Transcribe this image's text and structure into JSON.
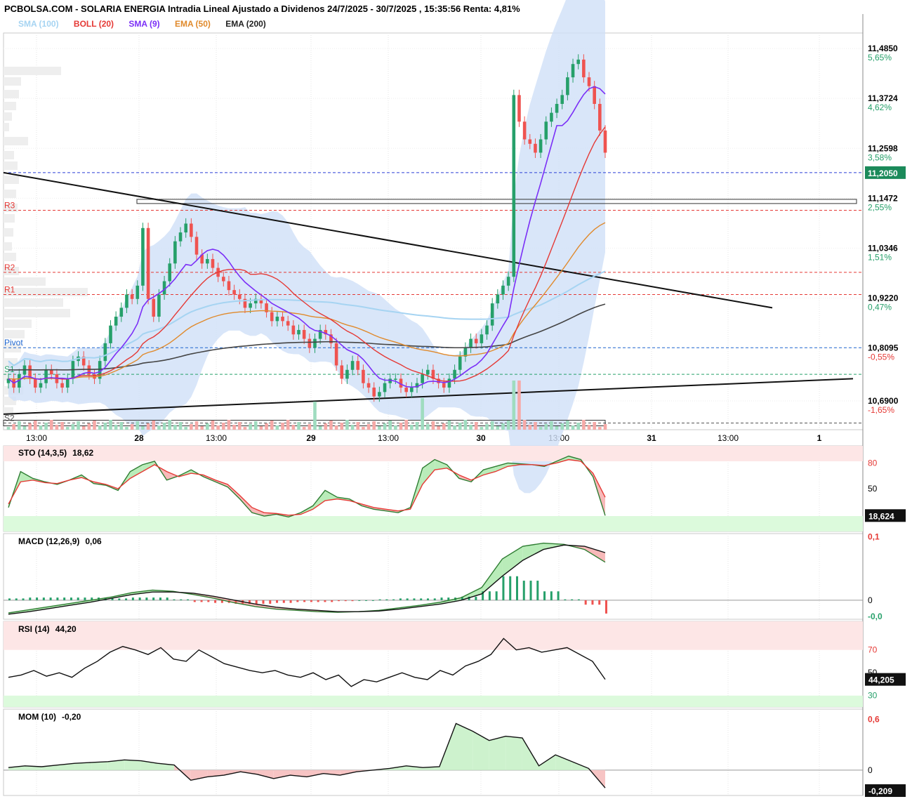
{
  "header": {
    "title": "PCBOLSA.COM - SOLARIA ENERGIA Intradia Lineal Ajustado a Dividenos 24/7/2025 - 30/7/2025 , 15:35:56 Renta: 4,81%"
  },
  "legend": [
    {
      "label": "SMA (100)",
      "color": "#a6d4f2"
    },
    {
      "label": "BOLL (20)",
      "color": "#e53935"
    },
    {
      "label": "SMA (9)",
      "color": "#7b2ff7"
    },
    {
      "label": "EMA (50)",
      "color": "#e08a2c"
    },
    {
      "label": "EMA (200)",
      "color": "#333333"
    }
  ],
  "colors": {
    "up": "#26a06a",
    "down": "#ef5350",
    "band": "#cfe0f7",
    "last_tag": "#1b8a5a"
  },
  "price_axis": {
    "ticks": [
      {
        "value": "11,4850",
        "pct": "5,65%"
      },
      {
        "value": "11,3724",
        "pct": "4,62%"
      },
      {
        "value": "11,2598",
        "pct": "3,58%"
      },
      {
        "value": "11,1472",
        "pct": "2,55%"
      },
      {
        "value": "11,0346",
        "pct": "1,51%"
      },
      {
        "value": "10,9220",
        "pct": "0,47%"
      },
      {
        "value": "10,8095",
        "pct": "-0,55%"
      },
      {
        "value": "10,6900",
        "pct": "-1,65%"
      }
    ],
    "last_price": "11,2050"
  },
  "x_axis": [
    "13:00",
    "28",
    "13:00",
    "29",
    "13:00",
    "30",
    "13:00",
    "31",
    "13:00",
    "1"
  ],
  "pivots": [
    {
      "label": "R3",
      "value": 11.12
    },
    {
      "label": "R2",
      "value": 10.98
    },
    {
      "label": "R1",
      "value": 10.93
    },
    {
      "label": "Pivot",
      "value": 10.81
    },
    {
      "label": "S1",
      "value": 10.75
    },
    {
      "label": "S2",
      "value": 10.64
    }
  ],
  "panels": {
    "sto": {
      "title": "STO (14,3,5)",
      "value": "18,62",
      "ticks": [
        "80",
        "50"
      ],
      "last": "18,624"
    },
    "macd": {
      "title": "MACD (12,26,9)",
      "value": "0,06",
      "ticks": [
        "0,1",
        "0",
        "-0,0"
      ]
    },
    "rsi": {
      "title": "RSI (14)",
      "value": "44,20",
      "ticks": [
        "70",
        "50",
        "30"
      ],
      "last": "44,205"
    },
    "mom": {
      "title": "MOM (10)",
      "value": "-0,20",
      "ticks": [
        "0,6",
        "0"
      ],
      "last": "-0,209"
    }
  },
  "chart_data": {
    "type": "candlestick",
    "close_series": [
      10.74,
      10.72,
      10.75,
      10.77,
      10.74,
      10.72,
      10.73,
      10.76,
      10.75,
      10.73,
      10.72,
      10.74,
      10.78,
      10.79,
      10.77,
      10.75,
      10.74,
      10.78,
      10.82,
      10.86,
      10.88,
      10.9,
      10.93,
      10.92,
      10.95,
      11.08,
      10.92,
      10.88,
      10.93,
      10.96,
      11.0,
      11.05,
      11.07,
      11.09,
      11.06,
      11.02,
      11.0,
      11.01,
      10.99,
      10.97,
      10.96,
      10.94,
      10.93,
      10.92,
      10.9,
      10.91,
      10.92,
      10.91,
      10.89,
      10.87,
      10.88,
      10.87,
      10.86,
      10.84,
      10.85,
      10.83,
      10.81,
      10.83,
      10.85,
      10.84,
      10.82,
      10.77,
      10.74,
      10.76,
      10.78,
      10.76,
      10.73,
      10.72,
      10.7,
      10.71,
      10.73,
      10.74,
      10.74,
      10.72,
      10.71,
      10.72,
      10.73,
      10.75,
      10.76,
      10.74,
      10.73,
      10.72,
      10.74,
      10.76,
      10.79,
      10.81,
      10.83,
      10.82,
      10.84,
      10.86,
      10.91,
      10.93,
      10.95,
      10.97,
      11.38,
      11.32,
      11.28,
      11.27,
      11.25,
      11.28,
      11.32,
      11.34,
      11.36,
      11.38,
      11.42,
      11.45,
      11.46,
      11.42,
      11.4,
      11.36,
      11.3,
      11.25
    ],
    "sto": {
      "k": [
        28,
        70,
        62,
        58,
        55,
        60,
        66,
        56,
        54,
        48,
        70,
        78,
        82,
        60,
        65,
        72,
        64,
        58,
        52,
        38,
        22,
        18,
        20,
        17,
        22,
        30,
        48,
        40,
        38,
        30,
        26,
        24,
        22,
        28,
        74,
        84,
        78,
        62,
        58,
        72,
        76,
        80,
        79,
        78,
        76,
        82,
        88,
        84,
        64,
        18.6
      ],
      "d": [
        32,
        58,
        60,
        57,
        56,
        60,
        63,
        58,
        55,
        50,
        62,
        70,
        78,
        70,
        64,
        68,
        66,
        60,
        55,
        42,
        28,
        22,
        21,
        19,
        20,
        26,
        36,
        38,
        36,
        32,
        28,
        26,
        24,
        26,
        55,
        72,
        74,
        66,
        60,
        66,
        70,
        76,
        78,
        78,
        77,
        80,
        84,
        82,
        68,
        40
      ]
    },
    "macd": {
      "macd": [
        -0.02,
        -0.015,
        -0.01,
        -0.005,
        0.0,
        0.005,
        0.012,
        0.016,
        0.014,
        0.009,
        0.003,
        -0.004,
        -0.01,
        -0.014,
        -0.016,
        -0.018,
        -0.019,
        -0.018,
        -0.016,
        -0.012,
        -0.008,
        -0.003,
        0.004,
        0.02,
        0.065,
        0.085,
        0.09,
        0.088,
        0.08,
        0.06
      ],
      "signal": [
        -0.022,
        -0.018,
        -0.013,
        -0.008,
        -0.003,
        0.003,
        0.009,
        0.013,
        0.013,
        0.011,
        0.006,
        0.0,
        -0.006,
        -0.011,
        -0.014,
        -0.016,
        -0.018,
        -0.018,
        -0.017,
        -0.014,
        -0.01,
        -0.006,
        0.0,
        0.01,
        0.038,
        0.063,
        0.08,
        0.087,
        0.085,
        0.075
      ]
    },
    "rsi": [
      46,
      48,
      52,
      47,
      50,
      46,
      54,
      60,
      68,
      73,
      70,
      66,
      72,
      62,
      60,
      70,
      64,
      58,
      55,
      52,
      50,
      52,
      48,
      46,
      50,
      44,
      48,
      38,
      44,
      42,
      46,
      50,
      46,
      44,
      52,
      48,
      56,
      60,
      66,
      80,
      70,
      72,
      68,
      70,
      72,
      66,
      60,
      44.2
    ],
    "mom": [
      0.03,
      0.05,
      0.04,
      0.06,
      0.08,
      0.09,
      0.1,
      0.12,
      0.11,
      0.08,
      0.06,
      -0.12,
      -0.08,
      -0.06,
      -0.02,
      -0.05,
      -0.1,
      -0.06,
      -0.08,
      -0.04,
      -0.06,
      -0.02,
      0.0,
      0.02,
      0.05,
      0.03,
      0.04,
      0.55,
      0.46,
      0.35,
      0.4,
      0.38,
      0.05,
      0.18,
      0.1,
      0.02,
      -0.21
    ]
  }
}
